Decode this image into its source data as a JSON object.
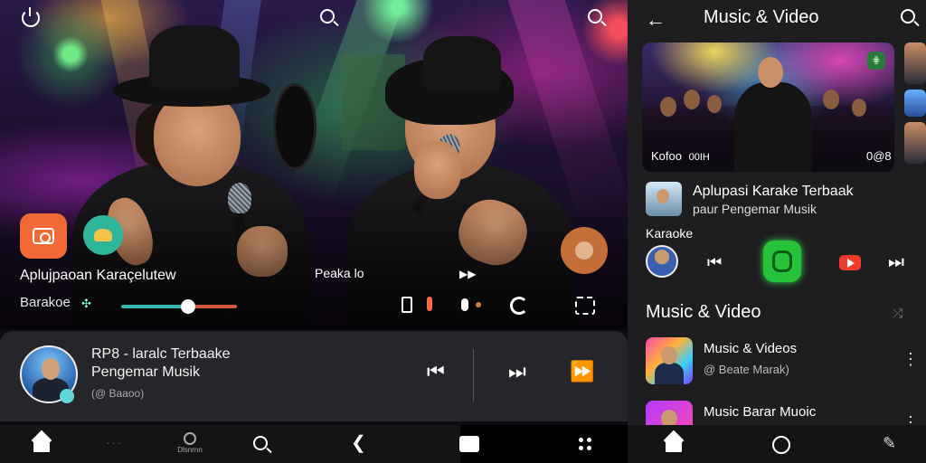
{
  "left_panel": {
    "stage": {
      "title": "Aplujpaoan Karaçelutew",
      "subtitle": "Barakoe",
      "peaks_label": "Peaka lo",
      "slider_progress": 0.58
    },
    "now_playing": {
      "title": "RP8 - laralc Terbaake",
      "subtitle": "Pengemar Musik",
      "meta": "(@ Baaoo)"
    },
    "bottom_nav": {
      "dots_label": "· · ·",
      "discover_label": "Dlsnrnn"
    }
  },
  "right_panel": {
    "header": {
      "title": "Music & Video"
    },
    "featured": {
      "left_label": "Kofoo",
      "left_suffix": "00IH",
      "right_label": "0@8",
      "chip": "⋕"
    },
    "app_card": {
      "name": "Aplupasi Karake Terbaak",
      "subtitle": "paur Pengemar Musik"
    },
    "karaoke_label": "Karaoke",
    "section_title": "Music & Video",
    "list": [
      {
        "title": "Music & Videos",
        "subtitle": "@ Beate Marak)"
      },
      {
        "title": "Music Barar Muoic",
        "subtitle": ""
      }
    ]
  },
  "colors": {
    "accent_orange": "#f16a36",
    "accent_teal": "#2fb59a",
    "accent_green": "#25c23a",
    "youtube_red": "#f23c2b",
    "panel_dark": "#1e1e20",
    "player_bg": "#26262a"
  },
  "icons": [
    "power-icon",
    "search-icon",
    "camera-icon",
    "users-icon",
    "profile-icon",
    "share-icon",
    "previous-icon",
    "next-icon",
    "fast-forward-icon",
    "home-icon",
    "discover-icon",
    "back-icon",
    "grid-icon",
    "shuffle-icon",
    "more-icon",
    "youtube-icon",
    "mic-icon"
  ]
}
